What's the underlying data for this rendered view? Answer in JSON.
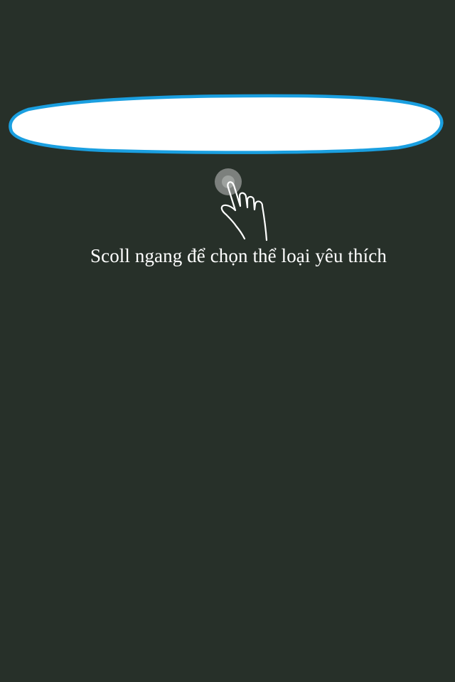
{
  "tutorial": {
    "hint_text": "Scoll ngang để chọn thể loại yêu thích",
    "gesture": "tap-and-swipe-horizontal",
    "hand_icon": "pointing-hand-icon"
  },
  "colors": {
    "background": "#273029",
    "highlight_fill": "#ffffff",
    "highlight_border": "#1a9fe0",
    "text": "#ffffff"
  }
}
